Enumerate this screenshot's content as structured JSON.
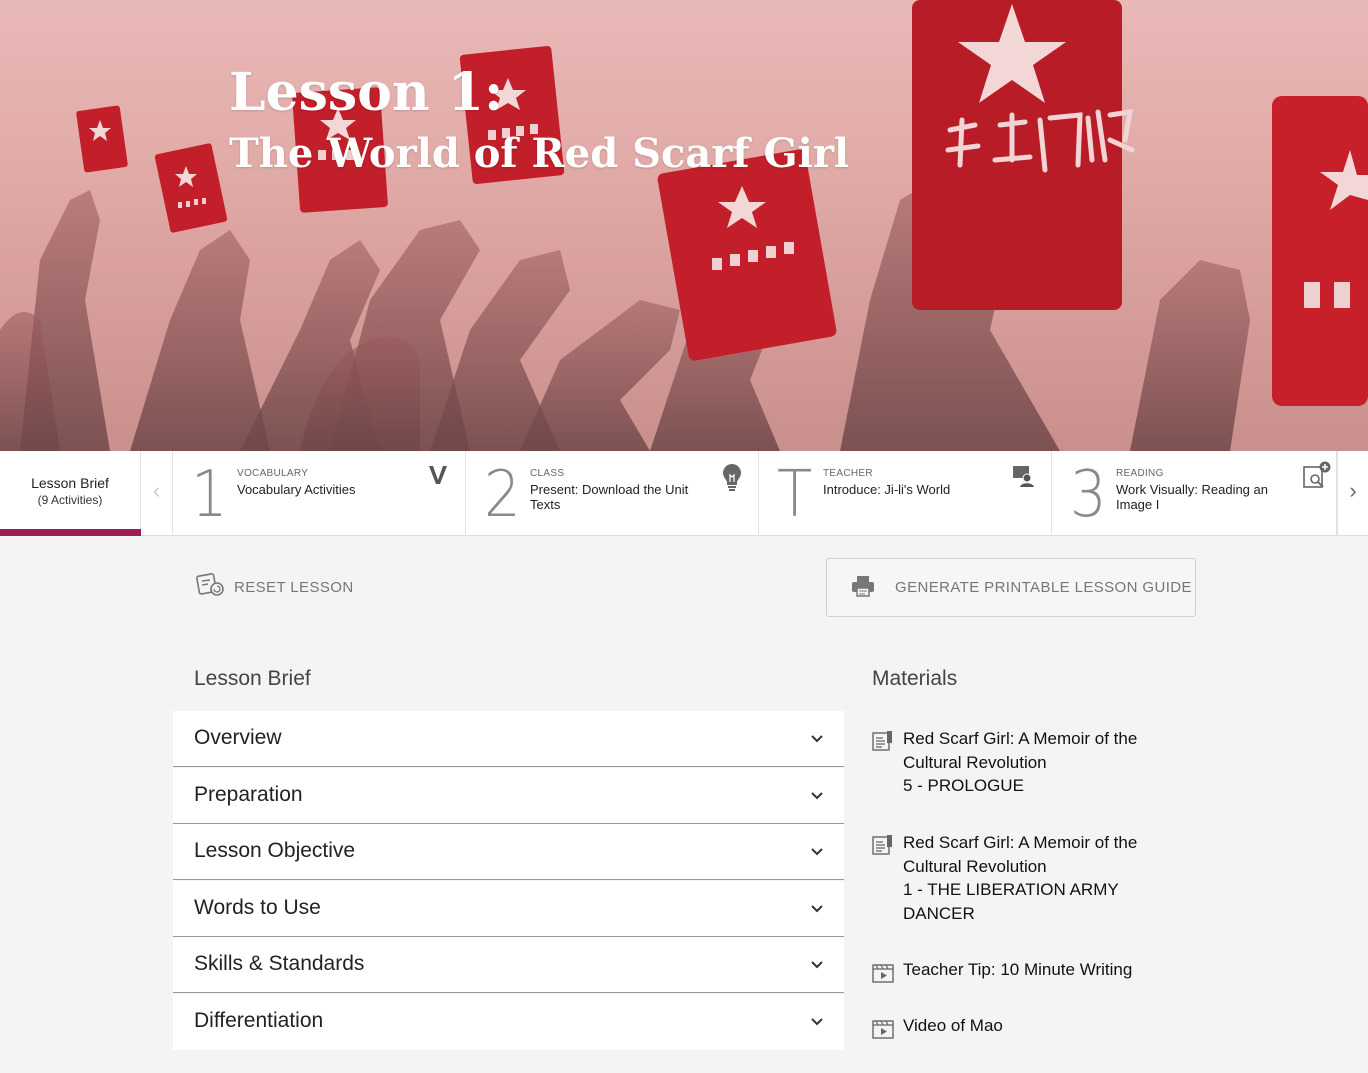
{
  "hero": {
    "title_line1": "Lesson 1:",
    "title_line2": "The World of Red Scarf Girl"
  },
  "activity_strip": {
    "brief_tab": {
      "label": "Lesson Brief",
      "count": "(9 Activities)"
    },
    "prev_icon": "chevron-left-icon",
    "next_icon": "chevron-right-icon",
    "activities": [
      {
        "marker": "1",
        "type": "VOCABULARY",
        "title": "Vocabulary Activities",
        "icon": "vocabulary-v-icon"
      },
      {
        "marker": "2",
        "type": "CLASS",
        "title": "Present: Download the Unit Texts",
        "icon": "lightbulb-icon"
      },
      {
        "marker": "T",
        "type": "TEACHER",
        "title": "Introduce: Ji-li's World",
        "icon": "teacher-presenter-icon"
      },
      {
        "marker": "3",
        "type": "READING",
        "title": "Work Visually: Reading an Image I",
        "icon": "reading-image-icon"
      }
    ]
  },
  "actions": {
    "reset_label": "RESET LESSON",
    "generate_label": "GENERATE PRINTABLE LESSON GUIDE"
  },
  "lesson_brief": {
    "heading": "Lesson Brief",
    "sections": [
      "Overview",
      "Preparation",
      "Lesson Objective",
      "Words to Use",
      "Skills & Standards",
      "Differentiation"
    ]
  },
  "materials": {
    "heading": "Materials",
    "items": [
      {
        "icon": "document-icon",
        "lines": [
          "Red Scarf Girl: A Memoir of the",
          "Cultural Revolution",
          "5 - PROLOGUE"
        ]
      },
      {
        "icon": "document-icon",
        "lines": [
          "Red Scarf Girl: A Memoir of the",
          "Cultural Revolution",
          "1 - THE LIBERATION ARMY",
          "DANCER"
        ]
      },
      {
        "icon": "video-icon",
        "lines": [
          "Teacher Tip: 10 Minute Writing"
        ]
      },
      {
        "icon": "video-icon",
        "lines": [
          "Video of Mao"
        ]
      }
    ]
  },
  "colors": {
    "accent": "#9d1d53",
    "hero_red": "#c21f2a",
    "background": "#f4f4f3"
  }
}
